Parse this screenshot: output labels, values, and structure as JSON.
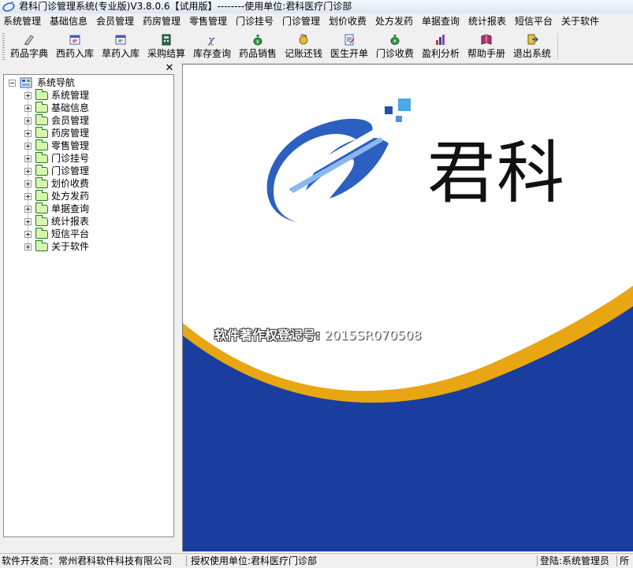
{
  "window": {
    "title": "君科门诊管理系统(专业版)V3.8.0.6【试用版】--------使用单位:君科医疗门诊部"
  },
  "menu": [
    "系统管理",
    "基础信息",
    "会员管理",
    "药房管理",
    "零售管理",
    "门诊挂号",
    "门诊管理",
    "划价收费",
    "处方发药",
    "单据查询",
    "统计报表",
    "短信平台",
    "关于软件"
  ],
  "toolbar": [
    {
      "label": "药品字典",
      "icon": "dictionary-icon"
    },
    {
      "label": "西药入库",
      "icon": "western-medicine-stock-in-icon"
    },
    {
      "label": "草药入库",
      "icon": "herbal-medicine-stock-in-icon"
    },
    {
      "label": "采购结算",
      "icon": "calculator-icon"
    },
    {
      "label": "库存查询",
      "icon": "formula-icon"
    },
    {
      "label": "药品销售",
      "icon": "money-bag-icon"
    },
    {
      "label": "记账还钱",
      "icon": "repayment-icon"
    },
    {
      "label": "医生开单",
      "icon": "prescription-icon"
    },
    {
      "label": "门诊收费",
      "icon": "cash-icon"
    },
    {
      "label": "盈利分析",
      "icon": "bar-chart-icon"
    },
    {
      "label": "帮助手册",
      "icon": "help-book-icon"
    },
    {
      "label": "退出系统",
      "icon": "exit-icon"
    }
  ],
  "nav": {
    "close_symbol": "✕",
    "root": "系统导航",
    "items": [
      "系统管理",
      "基础信息",
      "会员管理",
      "药房管理",
      "零售管理",
      "门诊挂号",
      "门诊管理",
      "划价收费",
      "处方发药",
      "单据查询",
      "统计报表",
      "短信平台",
      "关于软件"
    ]
  },
  "main": {
    "brand_name": "君科",
    "registration_label": "软件著作权登记号:",
    "registration_number": "2015SR070508",
    "colors": {
      "blue": "#1a3ea0",
      "gold": "#e8a612",
      "logo_blue": "#2c5fc0",
      "logo_light": "#4aa9e8"
    }
  },
  "status": {
    "developer": "软件开发商：常州君科软件科技有限公司",
    "licensee": "授权使用单位:君科医疗门诊部",
    "login": "登陆:系统管理员",
    "extra": "所"
  }
}
